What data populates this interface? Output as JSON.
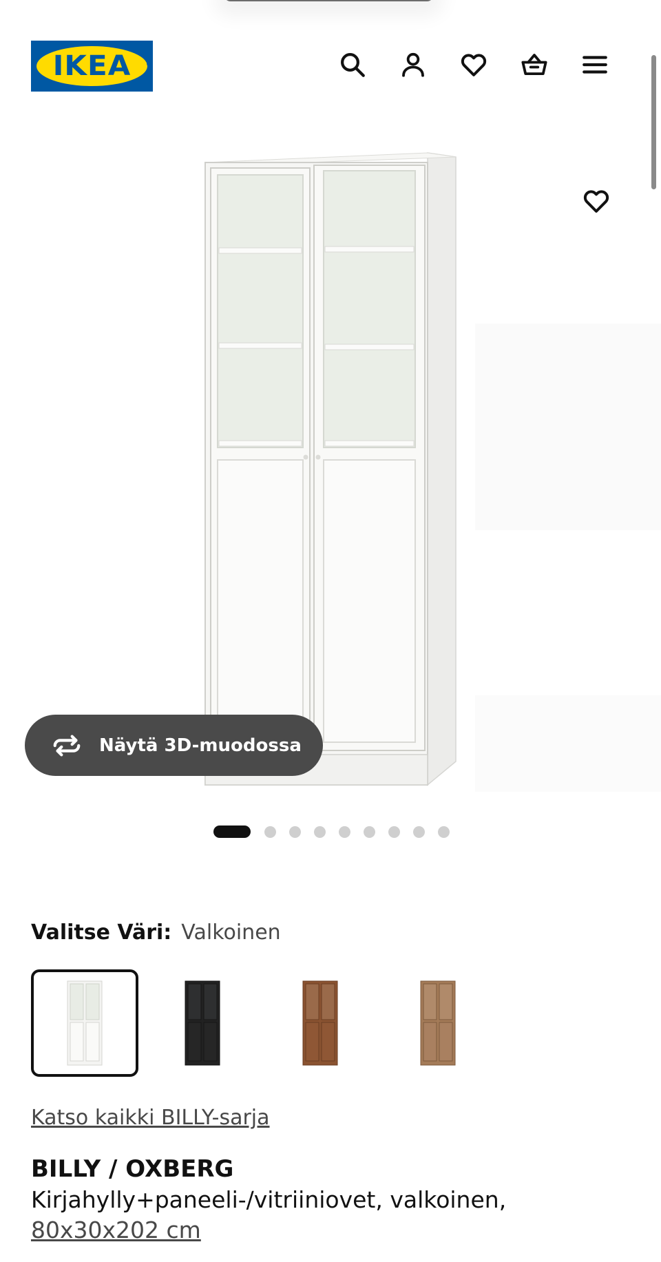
{
  "header": {
    "logo_text": "IKEA",
    "logo_reg": "®",
    "brand_blue": "#0058a3",
    "brand_yellow": "#ffdb00",
    "icons": [
      "search-icon",
      "user-icon",
      "heart-icon",
      "basket-icon",
      "menu-icon"
    ]
  },
  "gallery": {
    "view_3d_label": "Näytä 3D-muodossa",
    "image_count": 9,
    "active_index": 0
  },
  "color_select": {
    "label": "Valitse Väri:",
    "value": "Valkoinen",
    "options": [
      {
        "name": "white",
        "color": "#f4f4f2",
        "selected": true
      },
      {
        "name": "black",
        "color": "#222222",
        "selected": false
      },
      {
        "name": "brown-walnut",
        "color": "#8a5331",
        "selected": false
      },
      {
        "name": "oak",
        "color": "#a47b58",
        "selected": false
      }
    ]
  },
  "series_link": "Katso kaikki BILLY-sarja",
  "product": {
    "title": "BILLY / OXBERG",
    "description": "Kirjahylly+paneeli-/vitriiniovet, valkoinen,",
    "size": "80x30x202 cm"
  }
}
